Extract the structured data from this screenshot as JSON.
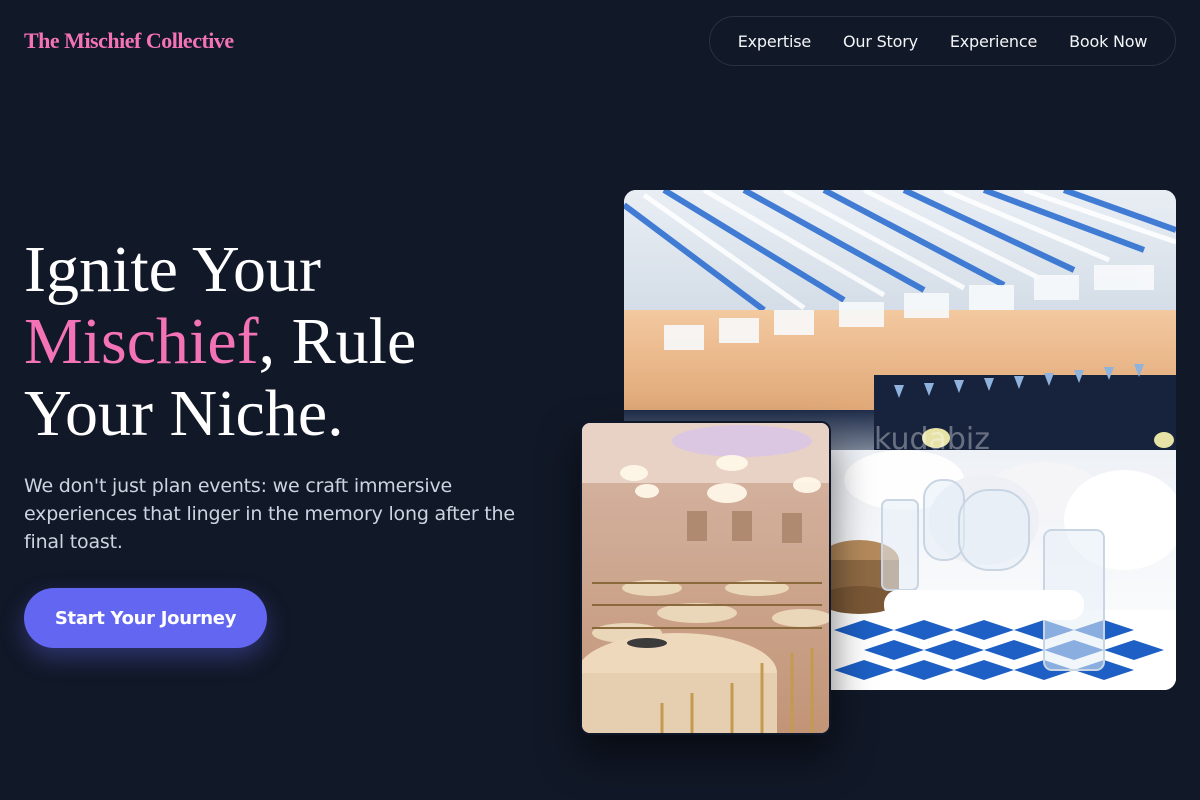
{
  "brand": {
    "name": "The Mischief Collective"
  },
  "nav": {
    "items": [
      {
        "label": "Expertise"
      },
      {
        "label": "Our Story"
      },
      {
        "label": "Experience"
      },
      {
        "label": "Book Now"
      }
    ]
  },
  "hero": {
    "headline_part1": "Ignite Your",
    "headline_accent": "Mischief",
    "headline_part2": ", Rule",
    "headline_part3": "Your Niche.",
    "lede": "We don't just plan events: we craft immersive experiences that linger in the memory long after the final toast.",
    "cta_label": "Start Your Journey"
  },
  "images": {
    "large_alt": "Event tables with blue and white decorations",
    "large_watermark": "kudabiz",
    "small_alt": "Chandelier ballroom with round tables"
  },
  "colors": {
    "background": "#111827",
    "accent_pink": "#f472b6",
    "cta_indigo": "#6366f1",
    "body_text": "#cbd5e1"
  }
}
